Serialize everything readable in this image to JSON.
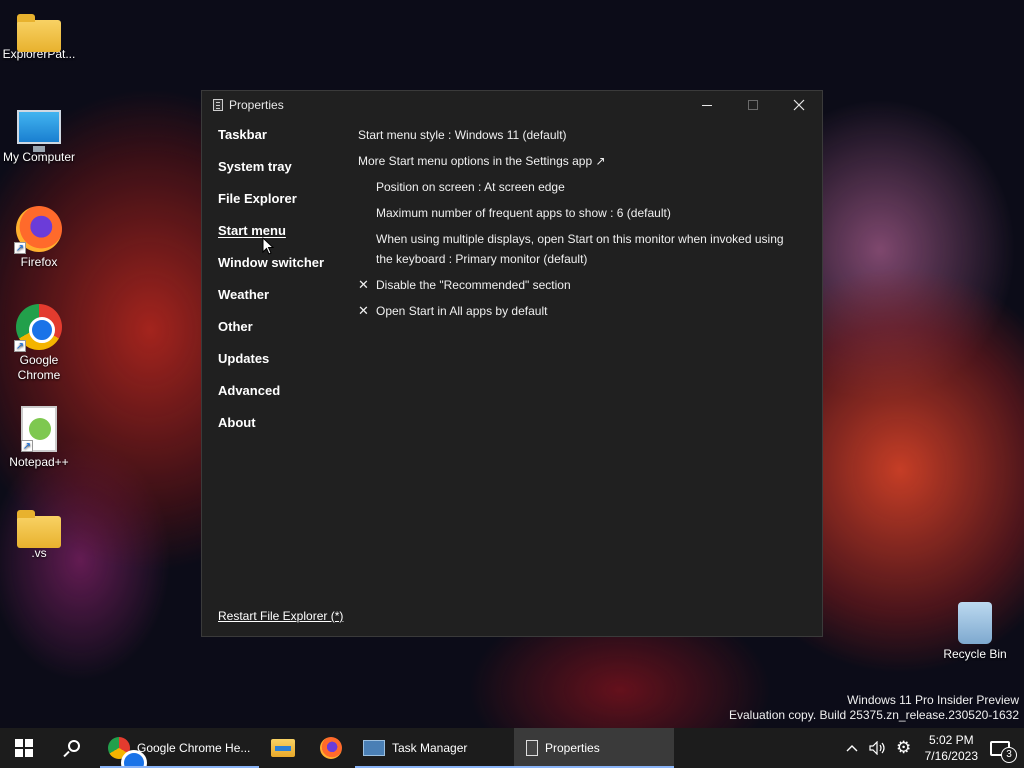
{
  "desktop": {
    "icons": [
      {
        "label": "ExplorerPat...",
        "icon": "folder-icon"
      },
      {
        "label": "My Computer",
        "icon": "monitor-icon"
      },
      {
        "label": "Firefox",
        "icon": "firefox-icon"
      },
      {
        "label": "Google Chrome",
        "icon": "chrome-icon"
      },
      {
        "label": "Notepad++",
        "icon": "notepadpp-icon"
      },
      {
        "label": ".vs",
        "icon": "folder-icon"
      },
      {
        "label": "Recycle Bin",
        "icon": "recycle-bin-icon"
      }
    ],
    "watermark": {
      "line1": "Windows 11 Pro Insider Preview",
      "line2": "Evaluation copy. Build 25375.zn_release.230520-1632"
    }
  },
  "window": {
    "title": "Properties",
    "nav": [
      {
        "label": "Taskbar"
      },
      {
        "label": "System tray"
      },
      {
        "label": "File Explorer"
      },
      {
        "label": "Start menu",
        "active": true
      },
      {
        "label": "Window switcher"
      },
      {
        "label": "Weather"
      },
      {
        "label": "Other"
      },
      {
        "label": "Updates"
      },
      {
        "label": "Advanced"
      },
      {
        "label": "About"
      }
    ],
    "settings": {
      "style": "Start menu style : Windows 11 (default)",
      "more_options": "More Start menu options in the Settings app ↗",
      "position": "Position on screen : At screen edge",
      "frequent_apps": "Maximum number of frequent apps to show : 6 (default)",
      "multi_display": "When using multiple displays, open Start on this monitor when invoked using the keyboard : Primary monitor (default)",
      "disable_recommended": "Disable the \"Recommended\" section",
      "all_apps_default": "Open Start in All apps by default",
      "check_mark": "✕"
    },
    "restart_link": "Restart File Explorer (*)"
  },
  "taskbar": {
    "apps": [
      {
        "label": "Google Chrome He...",
        "icon": "chrome-icon"
      },
      {
        "label": "",
        "icon": "file-explorer-icon"
      },
      {
        "label": "",
        "icon": "firefox-icon"
      },
      {
        "label": "Task Manager",
        "icon": "task-manager-icon"
      },
      {
        "label": "Properties",
        "icon": "properties-icon",
        "active": true
      }
    ],
    "clock": {
      "time": "5:02 PM",
      "date": "7/16/2023"
    },
    "notification_count": "3",
    "colors": {
      "bar": "#1c1c1c",
      "active": "#3a3a3a"
    }
  }
}
